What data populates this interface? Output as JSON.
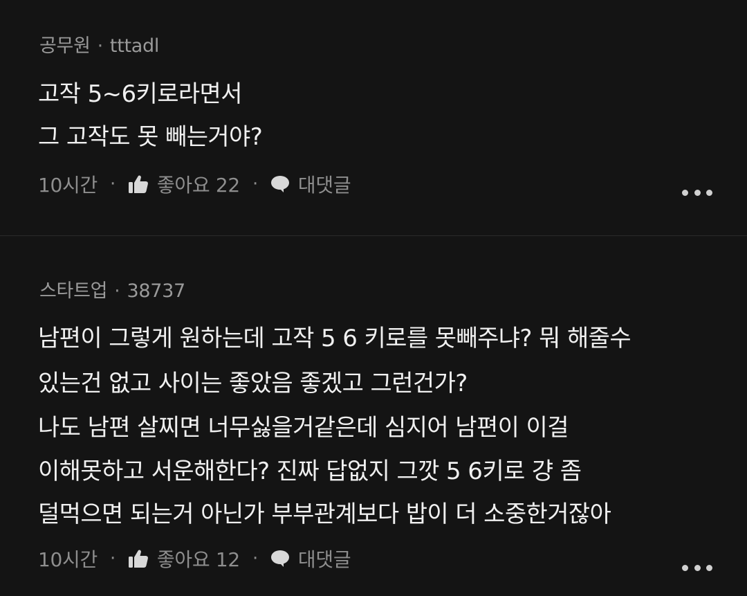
{
  "comments": [
    {
      "nickname": "공무원",
      "username": "tttadl",
      "lines": [
        "고작 5~6키로라면서",
        "그 고작도 못 빼는거야?"
      ],
      "time": "10시간",
      "like_label": "좋아요 22",
      "reply_label": "대댓글"
    },
    {
      "nickname": "스타트업",
      "username": "38737",
      "lines": [
        "남편이 그렇게 원하는데 고작 5 6 키로를 못빼주냐? 뭐 해줄수",
        "있는건 없고 사이는 좋았음 좋겠고 그런건가?",
        "나도 남편 살찌면 너무싫을거같은데 심지어 남편이 이걸",
        "이해못하고 서운해한다? 진짜 답없지 그깟 5 6키로 걍 좀",
        "덜먹으면 되는거 아닌가 부부관계보다 밥이 더 소중한거잖아"
      ],
      "time": "10시간",
      "like_label": "좋아요 12",
      "reply_label": "대댓글"
    }
  ],
  "separator": "·",
  "icons": {
    "like": "thumbs-up-icon",
    "reply": "speech-bubble-icon",
    "more": "more-dots-icon"
  },
  "colors": {
    "background": "#141414",
    "body_text": "#f0f0f0",
    "meta_text": "#8e8e8e",
    "author_text": "#9a9a9a"
  }
}
